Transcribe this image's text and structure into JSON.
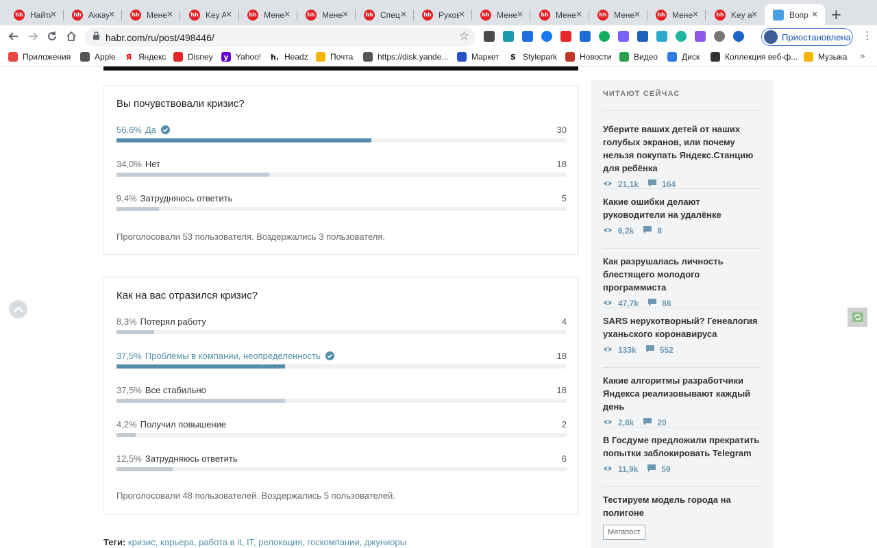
{
  "browser": {
    "tabs": [
      {
        "label": "Найти"
      },
      {
        "label": "Аккау"
      },
      {
        "label": "Мене"
      },
      {
        "label": "Key A"
      },
      {
        "label": "Мене"
      },
      {
        "label": "Мене"
      },
      {
        "label": "Спец"
      },
      {
        "label": "Руков"
      },
      {
        "label": "Мене"
      },
      {
        "label": "Мене"
      },
      {
        "label": "Мене"
      },
      {
        "label": "Мене"
      },
      {
        "label": "Key a"
      },
      {
        "label": "Вопр",
        "active": true
      }
    ],
    "favicon_text": "hh",
    "new_tab": "+",
    "url": "habr.com/ru/post/498446/",
    "profile_label": "Приостановлена",
    "bookmarks": [
      {
        "label": "Приложения",
        "icon": "apps-grid-icon"
      },
      {
        "label": "Apple",
        "icon": "apple-icon"
      },
      {
        "label": "Яндекс",
        "icon": "yandex-icon"
      },
      {
        "label": "Disney",
        "icon": "disney-icon"
      },
      {
        "label": "Yahoo!",
        "icon": "yahoo-icon"
      },
      {
        "label": "Headz",
        "icon": "headz-icon"
      },
      {
        "label": "Почта",
        "icon": "mail-icon"
      },
      {
        "label": "https://disk.yande...",
        "icon": "globe-icon"
      },
      {
        "label": "Маркет",
        "icon": "cart-icon"
      },
      {
        "label": "Stylepark",
        "icon": "stylepark-icon"
      },
      {
        "label": "Новости",
        "icon": "news-icon"
      },
      {
        "label": "Видео",
        "icon": "video-icon"
      },
      {
        "label": "Диск",
        "icon": "disk-icon"
      },
      {
        "label": "Коллекция веб-ф...",
        "icon": "collection-icon"
      },
      {
        "label": "Музыка",
        "icon": "music-icon"
      }
    ],
    "bookmarks_more": "»"
  },
  "polls": [
    {
      "question": "Вы почувствовали кризис?",
      "options": [
        {
          "percent": "56,6%",
          "label": "Да",
          "count": "30",
          "fill": 0.566,
          "selected": true
        },
        {
          "percent": "34,0%",
          "label": "Нет",
          "count": "18",
          "fill": 0.34,
          "selected": false
        },
        {
          "percent": "9,4%",
          "label": "Затрудняюсь ответить",
          "count": "5",
          "fill": 0.094,
          "selected": false
        }
      ],
      "footer": "Проголосовали 53 пользователя. Воздержались 3 пользователя."
    },
    {
      "question": "Как на вас отразился кризис?",
      "options": [
        {
          "percent": "8,3%",
          "label": "Потерял работу",
          "count": "4",
          "fill": 0.083,
          "selected": false
        },
        {
          "percent": "37,5%",
          "label": "Проблемы в компании, неопределенность",
          "count": "18",
          "fill": 0.375,
          "selected": true
        },
        {
          "percent": "37,5%",
          "label": "Все стабильно",
          "count": "18",
          "fill": 0.375,
          "selected": false
        },
        {
          "percent": "4,2%",
          "label": "Получил повышение",
          "count": "2",
          "fill": 0.042,
          "selected": false
        },
        {
          "percent": "12,5%",
          "label": "Затрудняюсь ответить",
          "count": "6",
          "fill": 0.125,
          "selected": false
        }
      ],
      "footer": "Проголосовали 48 пользователей. Воздержались 5 пользователей."
    }
  ],
  "tags": {
    "label": "Теги:",
    "items": [
      "кризис",
      "карьера",
      "работа в it",
      "IT",
      "релокация",
      "госкомпании",
      "джуниоры"
    ]
  },
  "sidebar": {
    "heading": "ЧИТАЮТ СЕЙЧАС",
    "articles": [
      {
        "title": "Уберите ваших детей от наших голубых экранов, или почему нельзя покупать Яндекс.Станцию для ребёнка",
        "views": "21,1k",
        "comments": "164"
      },
      {
        "title": "Какие ошибки делают руководители на удалёнке",
        "views": "6,2k",
        "comments": "8"
      },
      {
        "title": "Как разрушалась личность блестящего молодого программиста",
        "views": "47,7k",
        "comments": "88"
      },
      {
        "title": "SARS нерукотворный? Генеалогия уханьского коронавируса",
        "views": "133k",
        "comments": "552"
      },
      {
        "title": "Какие алгоритмы разработчики Яндекса реализовывают каждый день",
        "views": "2,8k",
        "comments": "20"
      },
      {
        "title": "В Госдуме предложили прекратить попытки заблокировать Telegram",
        "views": "11,9k",
        "comments": "59"
      }
    ],
    "last_article": {
      "title": "Тестируем модель города на полигоне",
      "badge": "Мегапост"
    }
  },
  "colors": {
    "accent": "#548eaa",
    "bar_track": "#eef0f2",
    "bar_fill": "#c3ccd3",
    "meta": "#6e99b3",
    "hh_red": "#e31e24"
  }
}
